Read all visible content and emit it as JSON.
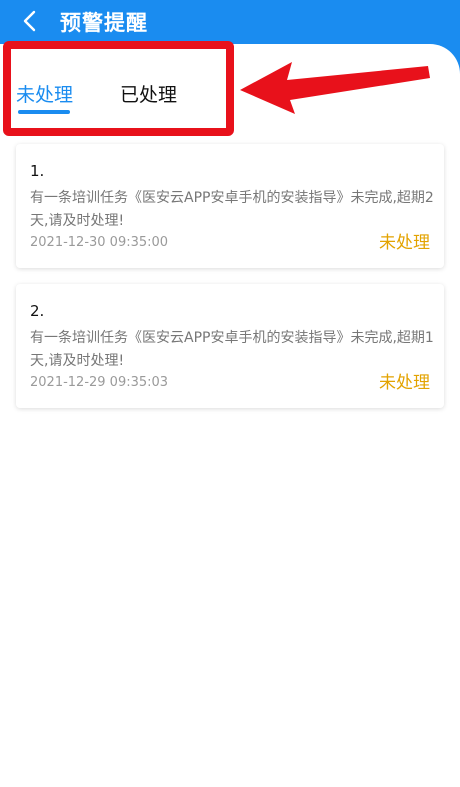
{
  "header": {
    "title": "预警提醒"
  },
  "tabs": [
    {
      "label": "未处理",
      "active": true
    },
    {
      "label": "已处理",
      "active": false
    }
  ],
  "colors": {
    "header_bg": "#1a8cf0",
    "active_tab": "#1a8cf0",
    "status": "#e3a300",
    "annotation": "#e8111b"
  },
  "icons": {
    "back": "chevron-left-icon",
    "annotation": "arrow-left-icon"
  },
  "cards": [
    {
      "number": "1.",
      "message": "有一条培训任务《医安云APP安卓手机的安装指导》未完成,超期2天,请及时处理!",
      "timestamp": "2021-12-30 09:35:00",
      "status": "未处理"
    },
    {
      "number": "2.",
      "message": "有一条培训任务《医安云APP安卓手机的安装指导》未完成,超期1天,请及时处理!",
      "timestamp": "2021-12-29 09:35:03",
      "status": "未处理"
    }
  ]
}
